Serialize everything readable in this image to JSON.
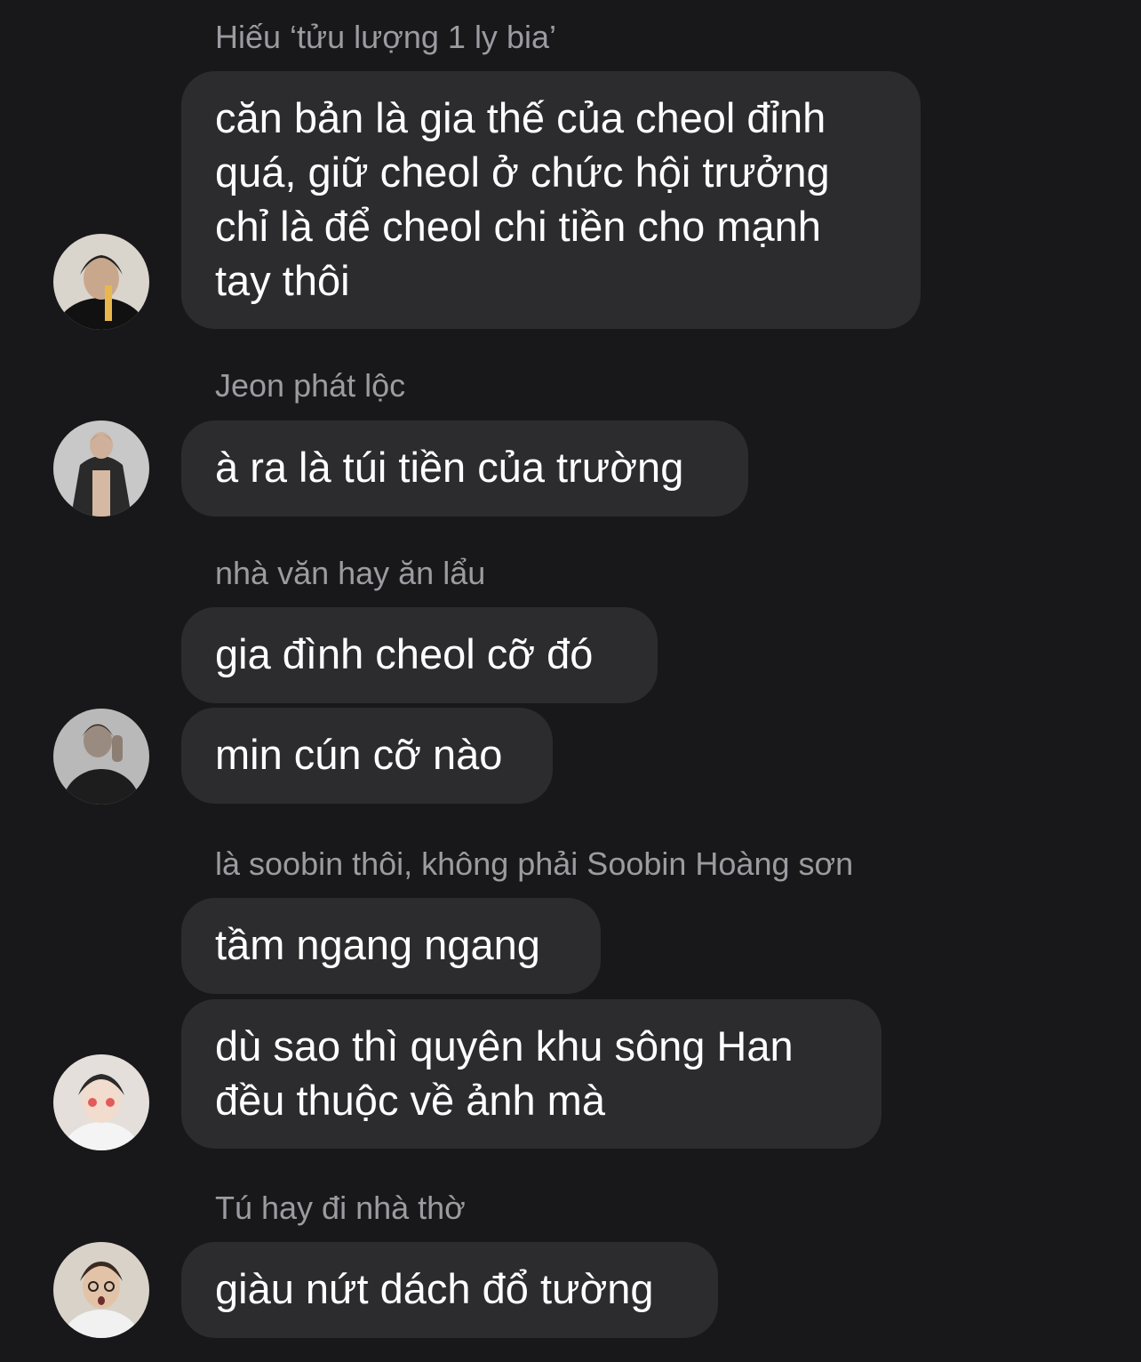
{
  "messages": [
    {
      "sender": "Hiếu ‘tửu lượng 1 ly bia’",
      "bubbles": [
        "căn bản là gia thế của cheol đỉnh\nquá, giữ cheol ở chức hội trưởng\nchỉ là để cheol chi tiền cho mạnh\ntay thôi"
      ]
    },
    {
      "sender": "Jeon phát lộc",
      "bubbles": [
        "à ra là túi tiền của trường"
      ]
    },
    {
      "sender": "nhà văn hay ăn lẩu",
      "bubbles": [
        "gia đình cheol cỡ đó",
        "min cún cỡ nào"
      ]
    },
    {
      "sender": "là soobin thôi, không phải Soobin Hoàng sơn",
      "bubbles": [
        "tầm ngang ngang",
        "dù sao thì quyên khu sông Han\nđều thuộc về ảnh mà"
      ]
    },
    {
      "sender": "Tú hay đi nhà thờ",
      "bubbles": [
        "giàu nứt dách đổ tường"
      ]
    }
  ],
  "avatars": [
    "user-avatar-photo",
    "user-avatar-photo",
    "user-avatar-photo",
    "user-avatar-photo",
    "user-avatar-photo"
  ],
  "colors": {
    "background": "#18181a",
    "bubble": "#2c2c2e",
    "sender_text": "#9b9ba1",
    "message_text": "#ffffff"
  }
}
